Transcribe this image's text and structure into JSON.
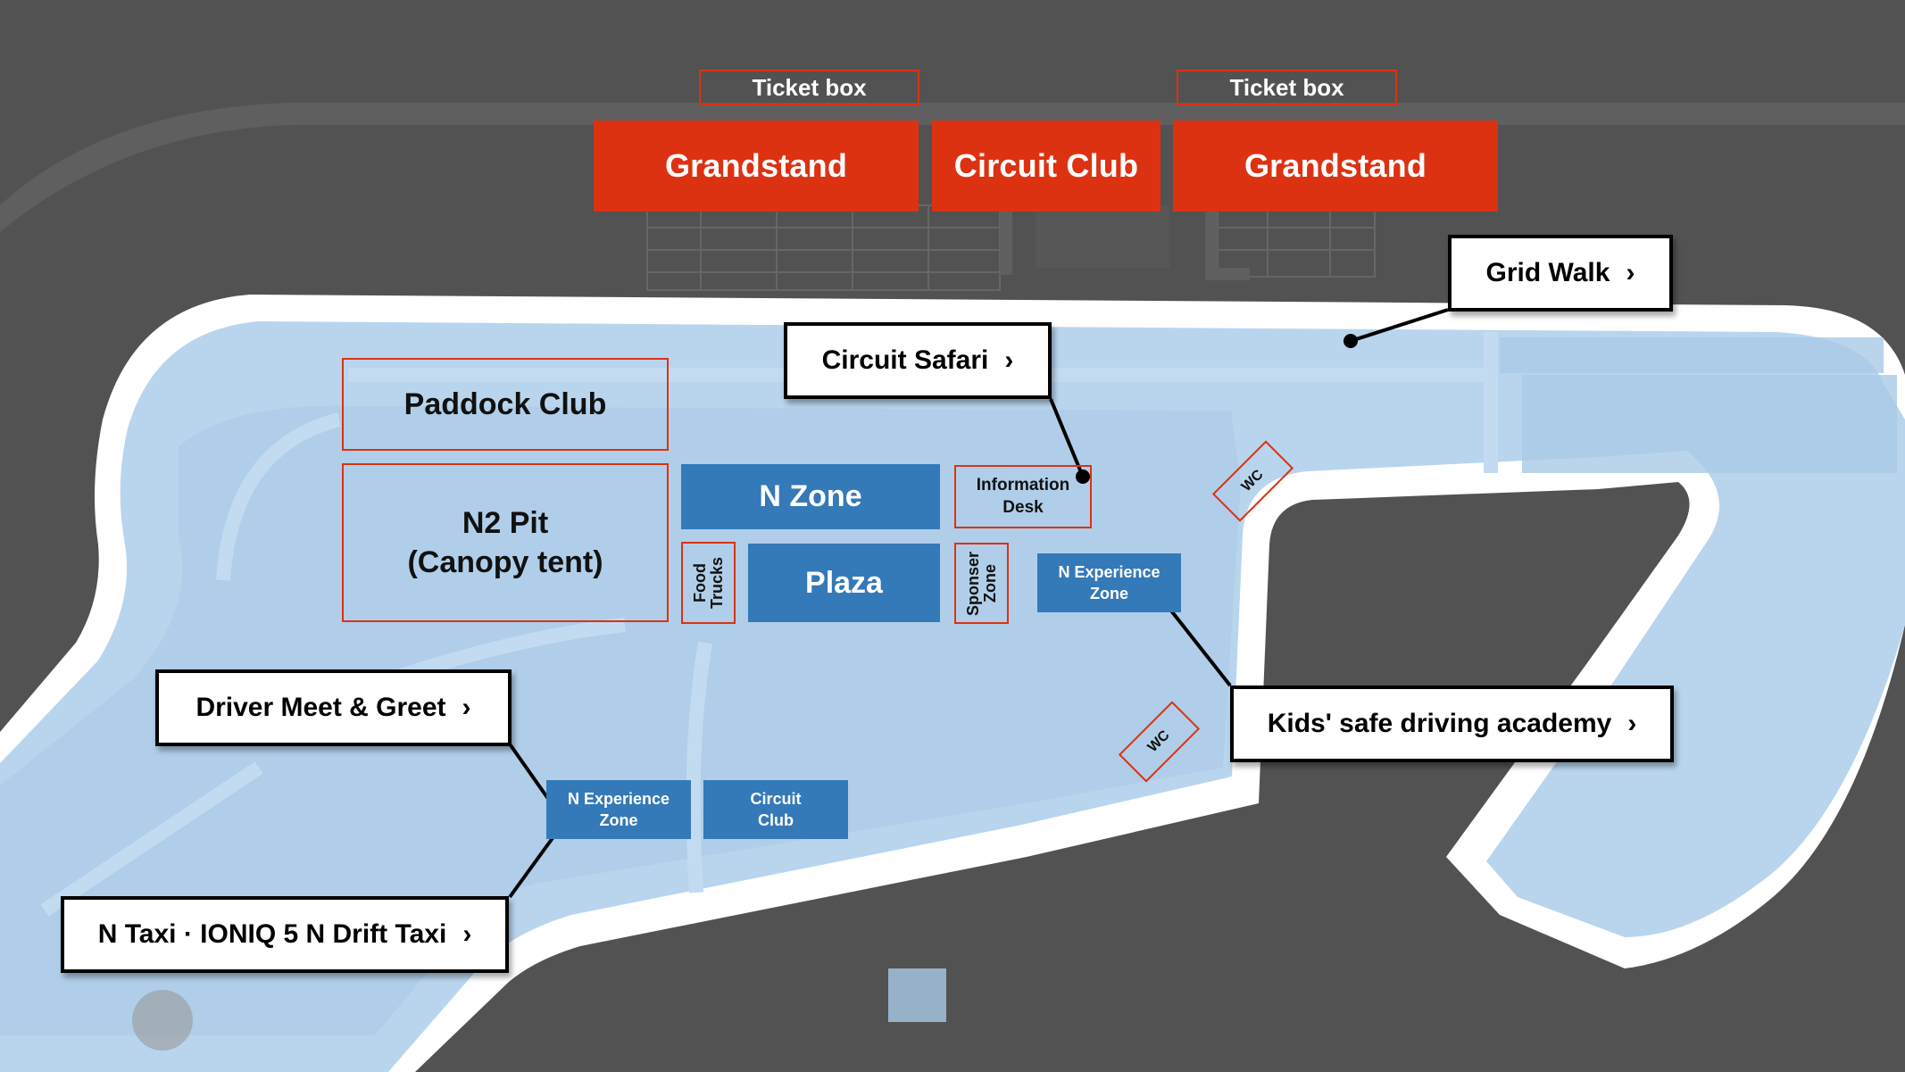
{
  "map": {
    "colors": {
      "background": "#525252",
      "track_surface": "#ffffff",
      "venue_area": "#b9d5ee",
      "venue_area_dark": "#a9c9e6",
      "highlight_red": "#dc3212",
      "zone_blue": "#3479b8"
    },
    "top_structures": {
      "ticket_boxes": [
        "Ticket box",
        "Ticket box"
      ],
      "stands": [
        "Grandstand",
        "Circuit Club",
        "Grandstand"
      ]
    },
    "zones": {
      "paddock_club": "Paddock Club",
      "n2_pit": {
        "line1": "N2 Pit",
        "line2": "(Canopy tent)"
      },
      "n_zone": "N Zone",
      "plaza": "Plaza",
      "food_trucks": {
        "line1": "Food",
        "line2": "Trucks"
      },
      "information_desk": {
        "line1": "Information",
        "line2": "Desk"
      },
      "sponser_zone": {
        "line1": "Sponser",
        "line2": "Zone"
      },
      "n_experience_zone_east": {
        "line1": "N Experience",
        "line2": "Zone"
      },
      "n_experience_zone_south": {
        "line1": "N Experience",
        "line2": "Zone"
      },
      "circuit_club_south": {
        "line1": "Circuit",
        "line2": "Club"
      },
      "wc": [
        "WC",
        "WC"
      ]
    },
    "callouts": [
      {
        "label": "Grid Walk",
        "icon": "chevron-right"
      },
      {
        "label": "Circuit Safari",
        "icon": "chevron-right"
      },
      {
        "label": "Kids' safe driving academy",
        "icon": "chevron-right"
      },
      {
        "label": "Driver Meet & Greet",
        "icon": "chevron-right"
      },
      {
        "label": "N Taxi · IONIQ 5 N Drift Taxi",
        "icon": "chevron-right"
      }
    ],
    "chevron_glyph": "›"
  }
}
